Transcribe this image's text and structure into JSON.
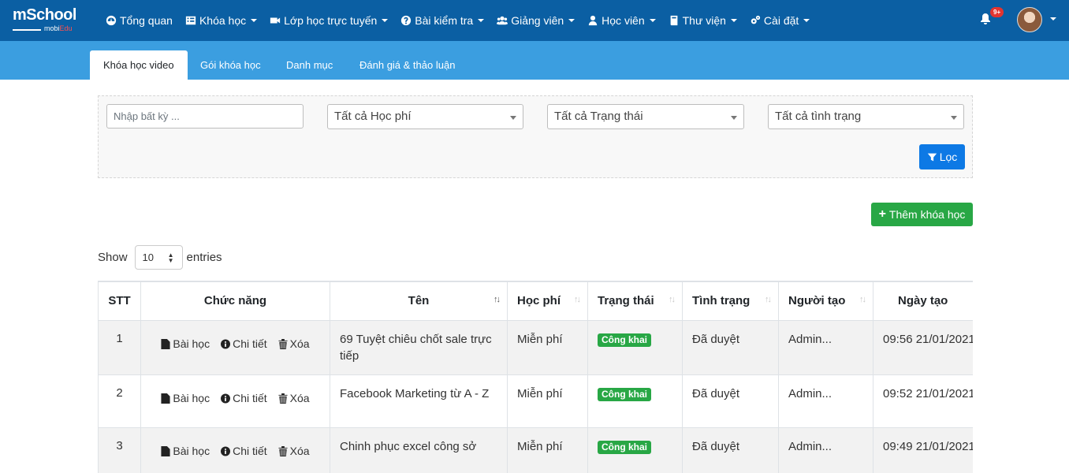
{
  "brand": {
    "logo_main": "mSchool",
    "logo_sub_a": "mobi",
    "logo_sub_b": "Edu"
  },
  "nav": [
    {
      "label": "Tổng quan",
      "icon": "dashboard-icon",
      "dropdown": false
    },
    {
      "label": "Khóa học",
      "icon": "list-icon",
      "dropdown": true
    },
    {
      "label": "Lớp học trực tuyến",
      "icon": "video-camera-icon",
      "dropdown": true
    },
    {
      "label": "Bài kiểm tra",
      "icon": "question-circle-icon",
      "dropdown": true
    },
    {
      "label": "Giảng viên",
      "icon": "users-icon",
      "dropdown": true
    },
    {
      "label": "Học viên",
      "icon": "user-icon",
      "dropdown": true
    },
    {
      "label": "Thư viện",
      "icon": "book-icon",
      "dropdown": true
    },
    {
      "label": "Cài đặt",
      "icon": "cogs-icon",
      "dropdown": true
    }
  ],
  "notifications": {
    "count": "9+"
  },
  "tabs": [
    {
      "label": "Khóa học video",
      "active": true
    },
    {
      "label": "Gói khóa học",
      "active": false
    },
    {
      "label": "Danh mục",
      "active": false
    },
    {
      "label": "Đánh giá & thảo luận",
      "active": false
    }
  ],
  "filter": {
    "search_placeholder": "Nhập bất kỳ ...",
    "fee_select": "Tất cả Học phí",
    "status_select": "Tất cả Trạng thái",
    "state_select": "Tất cả tình trạng",
    "filter_button": "Lọc"
  },
  "add_button": "Thêm khóa học",
  "length": {
    "show": "Show",
    "value": "10",
    "entries": "entries"
  },
  "table": {
    "headers": [
      "STT",
      "Chức năng",
      "Tên",
      "Học phí",
      "Trạng thái",
      "Tình trạng",
      "Người tạo",
      "Ngày tạo"
    ],
    "actions": {
      "lesson": "Bài học",
      "detail": "Chi tiết",
      "delete": "Xóa"
    },
    "rows": [
      {
        "stt": "1",
        "name": "69 Tuyệt chiêu chốt sale trực tiếp",
        "fee": "Miễn phí",
        "status": "Công khai",
        "state": "Đã duyệt",
        "creator": "Admin...",
        "created": "09:56 21/01/2021"
      },
      {
        "stt": "2",
        "name": "Facebook Marketing từ A - Z",
        "fee": "Miễn phí",
        "status": "Công khai",
        "state": "Đã duyệt",
        "creator": "Admin...",
        "created": "09:52 21/01/2021"
      },
      {
        "stt": "3",
        "name": "Chinh phục excel công sở",
        "fee": "Miễn phí",
        "status": "Công khai",
        "state": "Đã duyệt",
        "creator": "Admin...",
        "created": "09:49 21/01/2021"
      }
    ]
  },
  "colors": {
    "navbar": "#0b5fa3",
    "subbar": "#3b9ee0",
    "primary": "#0d79e5",
    "success": "#28a745"
  }
}
